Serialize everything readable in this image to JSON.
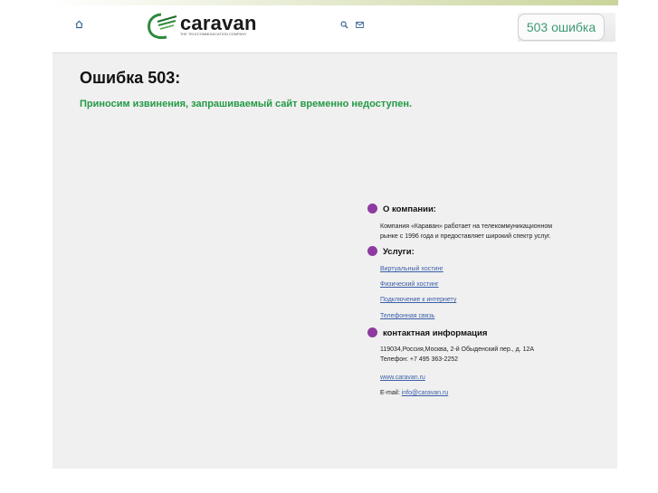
{
  "header": {
    "home_icon": "home-icon",
    "logo": {
      "word": "caravan",
      "subtitle": "THE TELECOMMUNICATION COMPANY"
    },
    "search_icon": "search-icon",
    "mail_icon": "mail-icon",
    "badge_text": "503 ошибка"
  },
  "main": {
    "title": "Ошибка 503:",
    "subtitle": "Приносим извинения, запрашиваемый сайт временно недоступен."
  },
  "sections": {
    "about": {
      "title": "О компании:",
      "text_line1": "Компания «Караван» работает на телекоммуникационном",
      "text_line2": "рынке с 1996 года и предоставляет широкий спектр услуг."
    },
    "services": {
      "title": "Услуги:",
      "links": [
        "Виртуальный хостинг",
        "Физический хостинг",
        "Подключение к интернету",
        "Телефонная связь"
      ]
    },
    "contacts": {
      "title": "контактная информация",
      "address": "119034,Россия,Москва, 2-й Обыденский пер., д. 12А",
      "phone": "Телефон: +7 495 363-2252",
      "website": "www.caravan.ru",
      "email_label": "E-mail:",
      "email": "info@caravan.ru"
    }
  },
  "colors": {
    "accent_green": "#239a45",
    "bullet_purple": "#8e3aa0",
    "link_blue": "#3a5fa8"
  }
}
